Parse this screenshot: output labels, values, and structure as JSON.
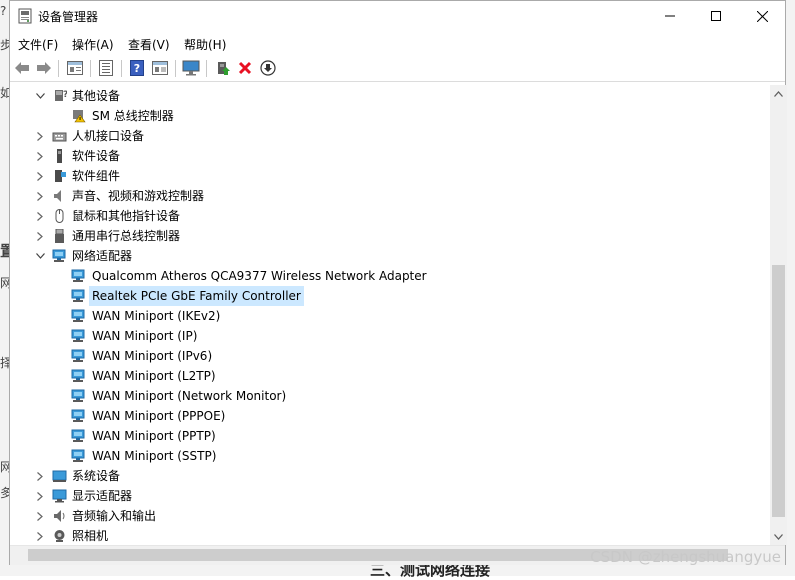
{
  "window": {
    "title": "设备管理器"
  },
  "menu": [
    "文件(F)",
    "操作(A)",
    "查看(V)",
    "帮助(H)"
  ],
  "toolbar": [
    "back-icon",
    "forward-icon",
    "properties-icon",
    "list-icon",
    "help-icon",
    "view-icon",
    "monitor-icon",
    "update-driver-icon",
    "uninstall-icon",
    "download-icon"
  ],
  "tree": [
    {
      "label": "其他设备",
      "expanded": true,
      "level": 0
    },
    {
      "label": "SM 总线控制器",
      "level": 1,
      "icon": "warning-device-icon"
    },
    {
      "label": "人机接口设备",
      "expanded": false,
      "level": 0
    },
    {
      "label": "软件设备",
      "expanded": false,
      "level": 0
    },
    {
      "label": "软件组件",
      "expanded": false,
      "level": 0
    },
    {
      "label": "声音、视频和游戏控制器",
      "expanded": false,
      "level": 0
    },
    {
      "label": "鼠标和其他指针设备",
      "expanded": false,
      "level": 0
    },
    {
      "label": "通用串行总线控制器",
      "expanded": false,
      "level": 0
    },
    {
      "label": "网络适配器",
      "expanded": true,
      "level": 0
    },
    {
      "label": "Qualcomm Atheros QCA9377 Wireless Network Adapter",
      "level": 1
    },
    {
      "label": "Realtek PCIe GbE Family Controller",
      "level": 1,
      "selected": true
    },
    {
      "label": "WAN Miniport (IKEv2)",
      "level": 1
    },
    {
      "label": "WAN Miniport (IP)",
      "level": 1
    },
    {
      "label": "WAN Miniport (IPv6)",
      "level": 1
    },
    {
      "label": "WAN Miniport (L2TP)",
      "level": 1
    },
    {
      "label": "WAN Miniport (Network Monitor)",
      "level": 1
    },
    {
      "label": "WAN Miniport (PPPOE)",
      "level": 1
    },
    {
      "label": "WAN Miniport (PPTP)",
      "level": 1
    },
    {
      "label": "WAN Miniport (SSTP)",
      "level": 1
    },
    {
      "label": "系统设备",
      "expanded": false,
      "level": 0
    },
    {
      "label": "显示适配器",
      "expanded": false,
      "level": 0
    },
    {
      "label": "音频输入和输出",
      "expanded": false,
      "level": 0
    },
    {
      "label": "照相机",
      "expanded": false,
      "level": 0
    }
  ],
  "background": {
    "left_fragments": [
      "?",
      "步",
      "如",
      "置",
      "网",
      "择",
      "网",
      "多"
    ],
    "bottom_text": "三、测试网络连接"
  },
  "watermark": "CSDN @zhengshuangyue",
  "colors": {
    "selection": "#cce8ff",
    "uninstall": "#e81123"
  }
}
